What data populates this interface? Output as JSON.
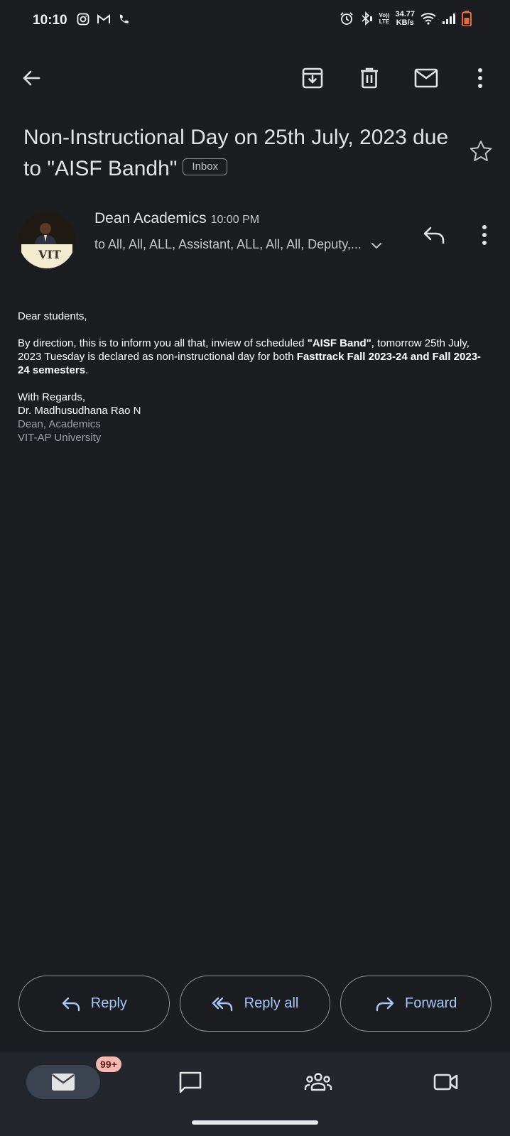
{
  "status_bar": {
    "time": "10:10",
    "speed_value": "34.77",
    "speed_unit": "KB/s",
    "volte_top": "Vo))",
    "volte_bottom": "LTE"
  },
  "toolbar": {
    "back_icon": "arrow-left-icon",
    "archive_icon": "archive-icon",
    "delete_icon": "trash-icon",
    "mark_unread_icon": "mail-icon",
    "more_icon": "more-vert-icon"
  },
  "email": {
    "subject": "Non-Instructional Day on 25th July, 2023 due to \"AISF Bandh\"",
    "label_chip": "Inbox",
    "sender": "Dean Academics",
    "time": "10:00 PM",
    "recipients": "to All, All, ALL, Assistant, ALL, All, All, Deputy,...",
    "avatar_text": "VIT",
    "body": {
      "greeting": "Dear students,",
      "p1_a": "By direction, this is to inform you all that,  inview of scheduled ",
      "p1_b": "\"AISF Band\"",
      "p1_c": ", tomorrow 25th July, 2023 Tuesday is declared as non-instructional day for both ",
      "p1_d": "Fasttrack Fall 2023-24 and Fall 2023-24 semesters",
      "p1_e": ".",
      "sign_1": "With Regards,",
      "sign_2": "Dr. Madhusudhana Rao N",
      "sign_3": "Dean, Academics",
      "sign_4": "VIT-AP University"
    }
  },
  "actions": {
    "reply": "Reply",
    "reply_all": "Reply all",
    "forward": "Forward"
  },
  "bottom_nav": {
    "mail_badge": "99+"
  },
  "colors": {
    "background": "#1b1d21",
    "accent": "#a8c7fa",
    "nav_background": "#23262c",
    "badge": "#f5b7b1"
  }
}
